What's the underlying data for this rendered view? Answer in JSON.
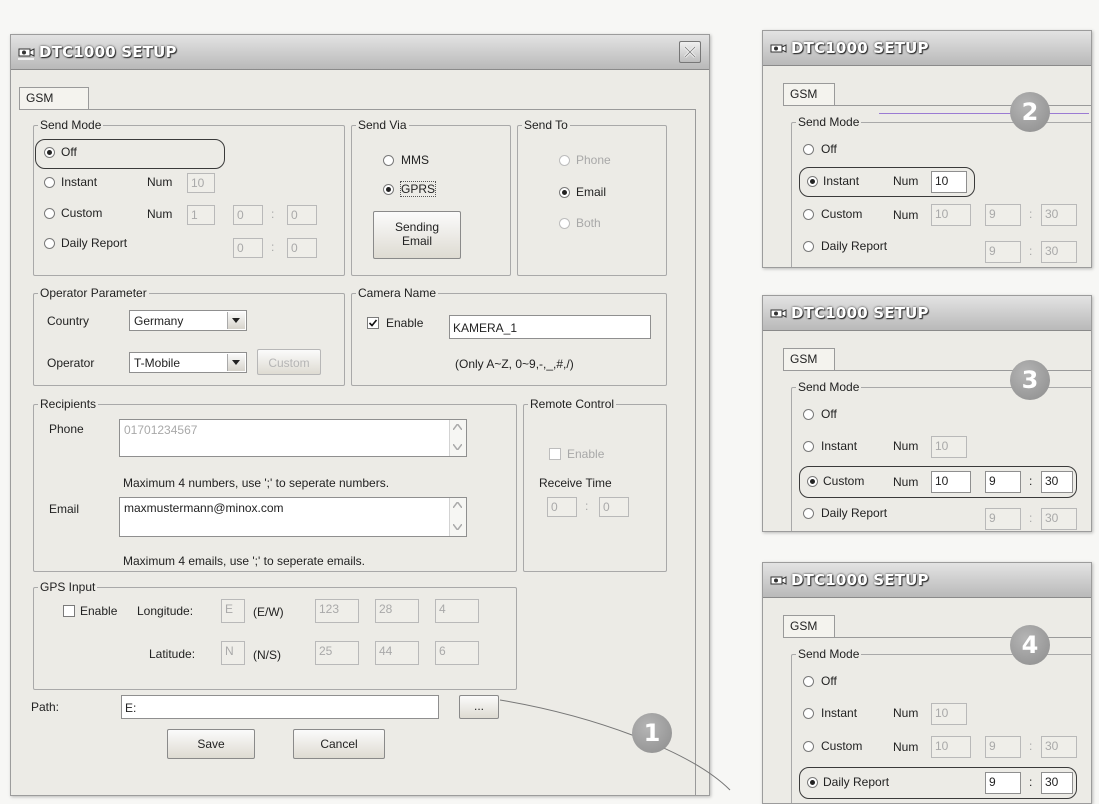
{
  "main": {
    "title": "DTC1000 SETUP",
    "tab": "GSM",
    "send_mode": {
      "legend": "Send Mode",
      "off": "Off",
      "instant": "Instant",
      "custom": "Custom",
      "daily": "Daily Report",
      "num_label": "Num",
      "instant_num": "10",
      "custom_num": "1",
      "custom_h": "0",
      "custom_m": "0",
      "daily_h": "0",
      "daily_m": "0",
      "selected": "off"
    },
    "send_via": {
      "legend": "Send Via",
      "mms": "MMS",
      "gprs": "GPRS",
      "sending_line1": "Sending",
      "sending_line2": "Email",
      "selected": "gprs"
    },
    "send_to": {
      "legend": "Send To",
      "phone": "Phone",
      "email": "Email",
      "both": "Both",
      "selected": "email"
    },
    "operator": {
      "legend": "Operator Parameter",
      "country_label": "Country",
      "country": "Germany",
      "operator_label": "Operator",
      "operator": "T-Mobile",
      "custom": "Custom"
    },
    "camera": {
      "legend": "Camera Name",
      "enable": "Enable",
      "name": "KAMERA_1",
      "hint": "(Only A~Z, 0~9,-,_,#,/)"
    },
    "recipients": {
      "legend": "Recipients",
      "phone_label": "Phone",
      "phone": "01701234567",
      "phone_hint": "Maximum 4 numbers, use ';' to  seperate  numbers.",
      "email_label": "Email",
      "email": "maxmustermann@minox.com",
      "email_hint": "Maximum 4 emails, use ';' to seperate emails."
    },
    "remote": {
      "legend": "Remote Control",
      "enable": "Enable",
      "receive": "Receive Time",
      "h": "0",
      "m": "0"
    },
    "gps": {
      "legend": "GPS Input",
      "enable": "Enable",
      "lon_label": "Longitude:",
      "lon_dir": "E",
      "lon_unit": "(E/W)",
      "lon_vals": [
        "123",
        "28",
        "4"
      ],
      "lat_label": "Latitude:",
      "lat_dir": "N",
      "lat_unit": "(N/S)",
      "lat_vals": [
        "25",
        "44",
        "6"
      ]
    },
    "path": {
      "label": "Path:",
      "value": "E:",
      "browse": "..."
    },
    "save": "Save",
    "cancel": "Cancel",
    "badge": "1"
  },
  "insets": [
    {
      "badge": "2",
      "title": "DTC1000 SETUP",
      "tab": "GSM",
      "legend": "Send Mode",
      "off": "Off",
      "instant": "Instant",
      "custom": "Custom",
      "daily": "Daily Report",
      "num": "Num",
      "instant_num": "10",
      "custom_num": "10",
      "custom_h": "9",
      "custom_m": "30",
      "daily_h": "9",
      "daily_m": "30",
      "selected": "instant"
    },
    {
      "badge": "3",
      "title": "DTC1000 SETUP",
      "tab": "GSM",
      "legend": "Send Mode",
      "off": "Off",
      "instant": "Instant",
      "custom": "Custom",
      "daily": "Daily Report",
      "num": "Num",
      "instant_num": "10",
      "custom_num": "10",
      "custom_h": "9",
      "custom_m": "30",
      "daily_h": "9",
      "daily_m": "30",
      "selected": "custom"
    },
    {
      "badge": "4",
      "title": "DTC1000 SETUP",
      "tab": "GSM",
      "legend": "Send Mode",
      "off": "Off",
      "instant": "Instant",
      "custom": "Custom",
      "daily": "Daily Report",
      "num": "Num",
      "instant_num": "10",
      "custom_num": "10",
      "custom_h": "9",
      "custom_m": "30",
      "daily_h": "9",
      "daily_m": "30",
      "selected": "daily"
    }
  ]
}
